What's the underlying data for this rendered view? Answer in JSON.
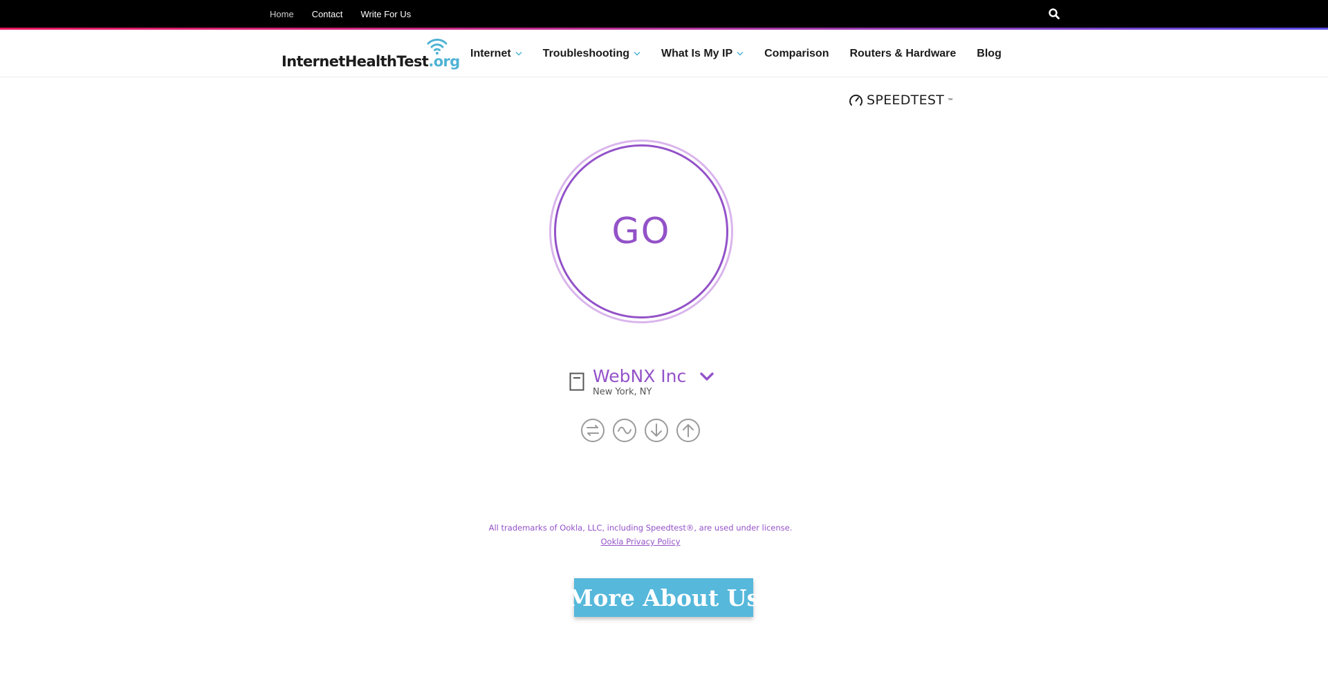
{
  "topbar": {
    "links": [
      {
        "label": "Home"
      },
      {
        "label": "Contact"
      },
      {
        "label": "Write For Us"
      }
    ]
  },
  "logo": {
    "main": "InternetHealthTest",
    "tld": ".org"
  },
  "nav": {
    "items": [
      {
        "label": "Internet"
      },
      {
        "label": "Troubleshooting"
      },
      {
        "label": "What Is My IP"
      },
      {
        "label": "Comparison"
      },
      {
        "label": "Routers & Hardware"
      },
      {
        "label": "Blog"
      }
    ]
  },
  "speedtest": {
    "brand": "SPEEDTEST",
    "go_label": "GO",
    "server_name": "WebNX Inc",
    "server_location": "New York, NY",
    "trademark": "All trademarks of Ookla, LLC, including Speedtest®, are used under license.",
    "privacy_link": "Ookla Privacy Policy"
  },
  "cta": {
    "label": "More About Us"
  },
  "colors": {
    "accent_purple": "#9352c8",
    "ring_light": "#d9b5ec",
    "cta_blue": "#56b8db",
    "topbar": "#000000"
  }
}
